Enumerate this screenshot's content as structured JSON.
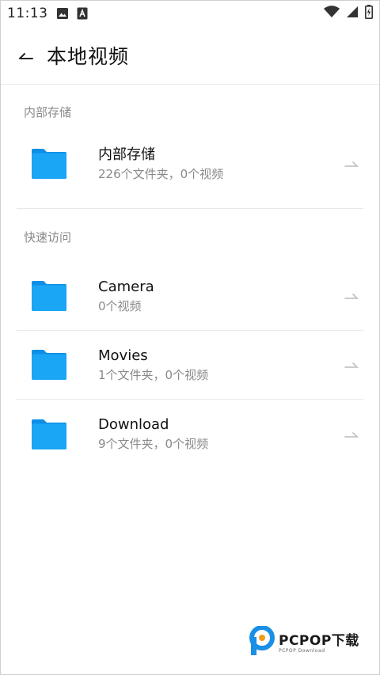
{
  "status_bar": {
    "time": "11:13"
  },
  "appbar": {
    "title": "本地视频"
  },
  "sections": {
    "internal": {
      "header": "内部存储"
    },
    "quick": {
      "header": "快速访问"
    }
  },
  "items": {
    "internal": {
      "name": "内部存储",
      "meta": "226个文件夹，0个视频"
    },
    "camera": {
      "name": "Camera",
      "meta": "0个视频"
    },
    "movies": {
      "name": "Movies",
      "meta": "1个文件夹，0个视频"
    },
    "download": {
      "name": "Download",
      "meta": "9个文件夹，0个视频"
    }
  },
  "watermark": {
    "main": "PCPOP下载",
    "sub": "PCPOP Download"
  },
  "colors": {
    "folder": "#1aa6f5",
    "folder_dark": "#0e8fe6",
    "secondary_text": "#8a8a8a"
  },
  "icons": [
    "image-icon",
    "a-icon",
    "wifi-icon",
    "signal-icon",
    "battery-icon",
    "back-arrow-icon",
    "folder-icon",
    "chevron-right-icon"
  ]
}
